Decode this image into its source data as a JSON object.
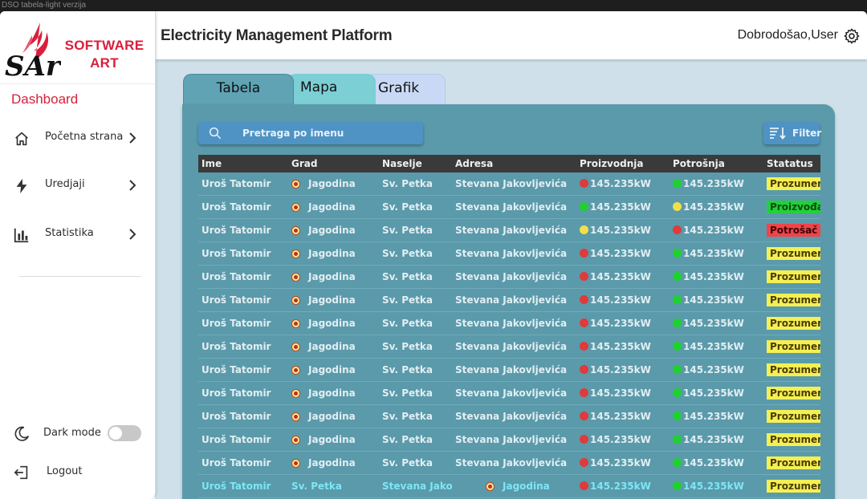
{
  "window": {
    "title": "DSO tabela-light verzija"
  },
  "brand": {
    "line1": "SOFTWARE",
    "line2": "ART",
    "logo_text": "SArt",
    "color": "#d81f3b"
  },
  "sidebar": {
    "title": "Dashboard",
    "items": [
      {
        "label": "Početna strana",
        "icon": "home-icon"
      },
      {
        "label": "Uredjaji",
        "icon": "lightning-icon"
      },
      {
        "label": "Statistika",
        "icon": "bar-chart-icon"
      }
    ],
    "dark_mode_label": "Dark mode",
    "dark_mode_on": false,
    "logout_label": "Logout"
  },
  "header": {
    "title": "Electricity Management Platform",
    "welcome": "Dobrodošao,User"
  },
  "tabs": [
    {
      "label": "Tabela",
      "active": true
    },
    {
      "label": "Mapa",
      "active": false
    },
    {
      "label": "Grafik",
      "active": false
    }
  ],
  "search": {
    "placeholder": "Pretraga po imenu"
  },
  "filter": {
    "label": "Filter"
  },
  "table": {
    "columns": [
      "Ime",
      "Grad",
      "Naselje",
      "Adresa",
      "Proizvodnja",
      "Potrošnja",
      "Statatus"
    ],
    "rows": [
      {
        "ime": "Uroš Tatomir",
        "grad": "Jagodina",
        "naselje": "Sv. Petka",
        "adresa": "Stevana Jakovljevića",
        "proizvodnja": "145.235kW",
        "p_face": "red",
        "potrosnja": "145.235kW",
        "c_face": "green",
        "status": "Prozumer",
        "status_type": "prozumer"
      },
      {
        "ime": "Uroš Tatomir",
        "grad": "Jagodina",
        "naselje": "Sv. Petka",
        "adresa": "Stevana Jakovljevića",
        "proizvodnja": "145.235kW",
        "p_face": "green",
        "potrosnja": "145.235kW",
        "c_face": "yellow",
        "status": "Proizvođač",
        "status_type": "proizvodac"
      },
      {
        "ime": "Uroš Tatomir",
        "grad": "Jagodina",
        "naselje": "Sv. Petka",
        "adresa": "Stevana Jakovljevića",
        "proizvodnja": "145.235kW",
        "p_face": "yellow",
        "potrosnja": "145.235kW",
        "c_face": "red",
        "status": "Potrošač",
        "status_type": "potrosac"
      },
      {
        "ime": "Uroš Tatomir",
        "grad": "Jagodina",
        "naselje": "Sv. Petka",
        "adresa": "Stevana Jakovljevića",
        "proizvodnja": "145.235kW",
        "p_face": "red",
        "potrosnja": "145.235kW",
        "c_face": "green",
        "status": "Prozumer",
        "status_type": "prozumer"
      },
      {
        "ime": "Uroš Tatomir",
        "grad": "Jagodina",
        "naselje": "Sv. Petka",
        "adresa": "Stevana Jakovljevića",
        "proizvodnja": "145.235kW",
        "p_face": "red",
        "potrosnja": "145.235kW",
        "c_face": "green",
        "status": "Prozumer",
        "status_type": "prozumer"
      },
      {
        "ime": "Uroš Tatomir",
        "grad": "Jagodina",
        "naselje": "Sv. Petka",
        "adresa": "Stevana Jakovljevića",
        "proizvodnja": "145.235kW",
        "p_face": "red",
        "potrosnja": "145.235kW",
        "c_face": "green",
        "status": "Prozumer",
        "status_type": "prozumer"
      },
      {
        "ime": "Uroš Tatomir",
        "grad": "Jagodina",
        "naselje": "Sv. Petka",
        "adresa": "Stevana Jakovljevića",
        "proizvodnja": "145.235kW",
        "p_face": "red",
        "potrosnja": "145.235kW",
        "c_face": "green",
        "status": "Prozumer",
        "status_type": "prozumer"
      },
      {
        "ime": "Uroš Tatomir",
        "grad": "Jagodina",
        "naselje": "Sv. Petka",
        "adresa": "Stevana Jakovljevića",
        "proizvodnja": "145.235kW",
        "p_face": "red",
        "potrosnja": "145.235kW",
        "c_face": "green",
        "status": "Prozumer",
        "status_type": "prozumer"
      },
      {
        "ime": "Uroš Tatomir",
        "grad": "Jagodina",
        "naselje": "Sv. Petka",
        "adresa": "Stevana Jakovljevića",
        "proizvodnja": "145.235kW",
        "p_face": "red",
        "potrosnja": "145.235kW",
        "c_face": "green",
        "status": "Prozumer",
        "status_type": "prozumer"
      },
      {
        "ime": "Uroš Tatomir",
        "grad": "Jagodina",
        "naselje": "Sv. Petka",
        "adresa": "Stevana Jakovljevića",
        "proizvodnja": "145.235kW",
        "p_face": "red",
        "potrosnja": "145.235kW",
        "c_face": "green",
        "status": "Prozumer",
        "status_type": "prozumer"
      },
      {
        "ime": "Uroš Tatomir",
        "grad": "Jagodina",
        "naselje": "Sv. Petka",
        "adresa": "Stevana Jakovljevića",
        "proizvodnja": "145.235kW",
        "p_face": "red",
        "potrosnja": "145.235kW",
        "c_face": "green",
        "status": "Prozumer",
        "status_type": "prozumer"
      },
      {
        "ime": "Uroš Tatomir",
        "grad": "Jagodina",
        "naselje": "Sv. Petka",
        "adresa": "Stevana Jakovljevića",
        "proizvodnja": "145.235kW",
        "p_face": "red",
        "potrosnja": "145.235kW",
        "c_face": "green",
        "status": "Prozumer",
        "status_type": "prozumer"
      },
      {
        "ime": "Uroš Tatomir",
        "grad": "Jagodina",
        "naselje": "Sv. Petka",
        "adresa": "Stevana Jakovljevića",
        "proizvodnja": "145.235kW",
        "p_face": "red",
        "potrosnja": "145.235kW",
        "c_face": "green",
        "status": "Prozumer",
        "status_type": "prozumer"
      }
    ],
    "highlight_row": {
      "ime": "Uroš Tatomir",
      "col2": "Sv. Petka",
      "col3": "Stevana Jakovljevića",
      "col4": "Jagodina",
      "proizvodnja": "145.235kW",
      "p_face": "red",
      "potrosnja": "145.235kW",
      "c_face": "green",
      "status": "Prozumer",
      "status_type": "prozumer"
    }
  },
  "colors": {
    "accent": "#d81f3b",
    "panel": "#5a9aaa",
    "content_bg": "#cfe0ea",
    "header_row": "#3a3a3a",
    "button": "#4f93c4"
  }
}
